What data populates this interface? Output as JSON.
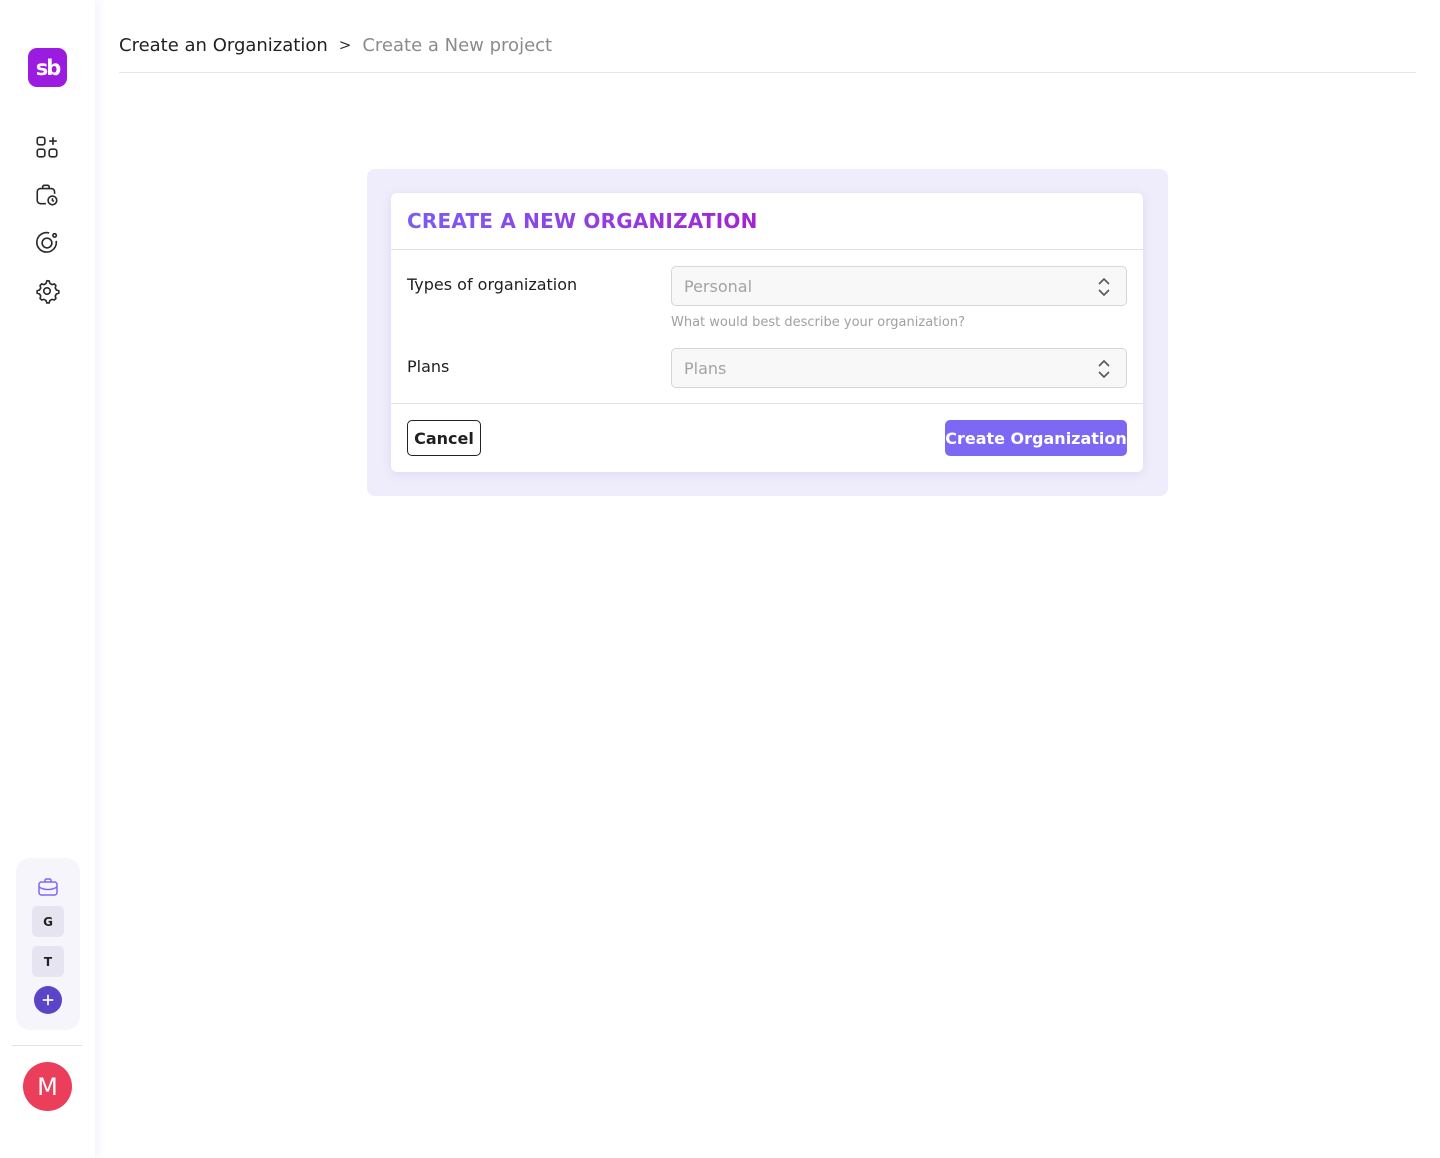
{
  "sidebar": {
    "logo_text": "sb",
    "nav_icons": [
      "add-widget-icon",
      "calendar-clock-icon",
      "target-icon",
      "gear-icon"
    ],
    "workspaces": {
      "icon": "briefcase-icon",
      "items": [
        {
          "letter": "G"
        },
        {
          "letter": "T"
        }
      ],
      "add_icon": "plus-icon"
    },
    "avatar_letter": "M"
  },
  "header": {
    "breadcrumb": [
      {
        "label": "Create an Organization"
      },
      {
        "label": "Create a New project"
      }
    ],
    "separator": ">"
  },
  "card": {
    "title": "CREATE A NEW ORGANIZATION",
    "fields": {
      "org_type": {
        "label": "Types of organization",
        "value": "Personal",
        "help": "What would best describe your organization?"
      },
      "plans": {
        "label": "Plans",
        "value": "Plans"
      }
    },
    "cancel_label": "Cancel",
    "submit_label": "Create Organization"
  },
  "colors": {
    "brand": "#9b1be0",
    "accent": "#7d68f6",
    "avatar": "#ea3e5a",
    "workspace_add": "#5b45c6"
  }
}
